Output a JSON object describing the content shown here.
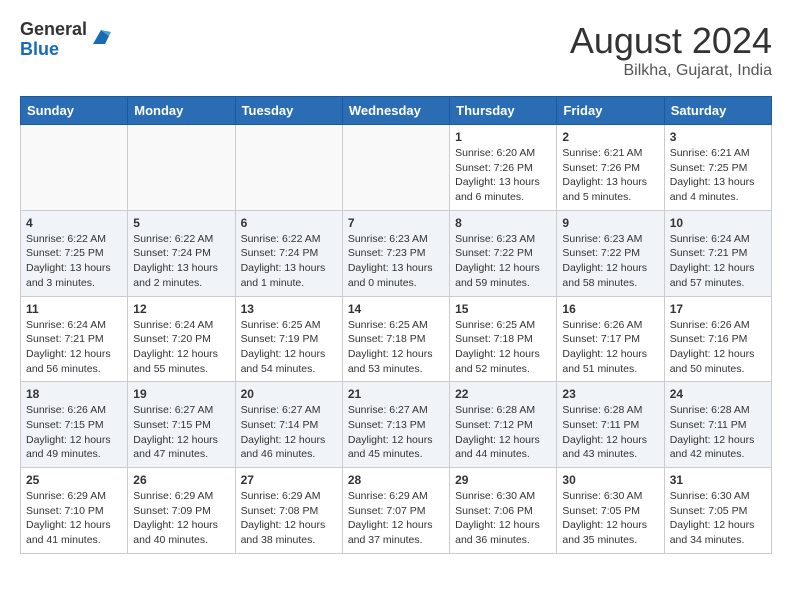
{
  "header": {
    "logo_general": "General",
    "logo_blue": "Blue",
    "month_year": "August 2024",
    "location": "Bilkha, Gujarat, India"
  },
  "calendar": {
    "days_of_week": [
      "Sunday",
      "Monday",
      "Tuesday",
      "Wednesday",
      "Thursday",
      "Friday",
      "Saturday"
    ],
    "weeks": [
      [
        {
          "day": "",
          "info": ""
        },
        {
          "day": "",
          "info": ""
        },
        {
          "day": "",
          "info": ""
        },
        {
          "day": "",
          "info": ""
        },
        {
          "day": "1",
          "info": "Sunrise: 6:20 AM\nSunset: 7:26 PM\nDaylight: 13 hours\nand 6 minutes."
        },
        {
          "day": "2",
          "info": "Sunrise: 6:21 AM\nSunset: 7:26 PM\nDaylight: 13 hours\nand 5 minutes."
        },
        {
          "day": "3",
          "info": "Sunrise: 6:21 AM\nSunset: 7:25 PM\nDaylight: 13 hours\nand 4 minutes."
        }
      ],
      [
        {
          "day": "4",
          "info": "Sunrise: 6:22 AM\nSunset: 7:25 PM\nDaylight: 13 hours\nand 3 minutes."
        },
        {
          "day": "5",
          "info": "Sunrise: 6:22 AM\nSunset: 7:24 PM\nDaylight: 13 hours\nand 2 minutes."
        },
        {
          "day": "6",
          "info": "Sunrise: 6:22 AM\nSunset: 7:24 PM\nDaylight: 13 hours\nand 1 minute."
        },
        {
          "day": "7",
          "info": "Sunrise: 6:23 AM\nSunset: 7:23 PM\nDaylight: 13 hours\nand 0 minutes."
        },
        {
          "day": "8",
          "info": "Sunrise: 6:23 AM\nSunset: 7:22 PM\nDaylight: 12 hours\nand 59 minutes."
        },
        {
          "day": "9",
          "info": "Sunrise: 6:23 AM\nSunset: 7:22 PM\nDaylight: 12 hours\nand 58 minutes."
        },
        {
          "day": "10",
          "info": "Sunrise: 6:24 AM\nSunset: 7:21 PM\nDaylight: 12 hours\nand 57 minutes."
        }
      ],
      [
        {
          "day": "11",
          "info": "Sunrise: 6:24 AM\nSunset: 7:21 PM\nDaylight: 12 hours\nand 56 minutes."
        },
        {
          "day": "12",
          "info": "Sunrise: 6:24 AM\nSunset: 7:20 PM\nDaylight: 12 hours\nand 55 minutes."
        },
        {
          "day": "13",
          "info": "Sunrise: 6:25 AM\nSunset: 7:19 PM\nDaylight: 12 hours\nand 54 minutes."
        },
        {
          "day": "14",
          "info": "Sunrise: 6:25 AM\nSunset: 7:18 PM\nDaylight: 12 hours\nand 53 minutes."
        },
        {
          "day": "15",
          "info": "Sunrise: 6:25 AM\nSunset: 7:18 PM\nDaylight: 12 hours\nand 52 minutes."
        },
        {
          "day": "16",
          "info": "Sunrise: 6:26 AM\nSunset: 7:17 PM\nDaylight: 12 hours\nand 51 minutes."
        },
        {
          "day": "17",
          "info": "Sunrise: 6:26 AM\nSunset: 7:16 PM\nDaylight: 12 hours\nand 50 minutes."
        }
      ],
      [
        {
          "day": "18",
          "info": "Sunrise: 6:26 AM\nSunset: 7:15 PM\nDaylight: 12 hours\nand 49 minutes."
        },
        {
          "day": "19",
          "info": "Sunrise: 6:27 AM\nSunset: 7:15 PM\nDaylight: 12 hours\nand 47 minutes."
        },
        {
          "day": "20",
          "info": "Sunrise: 6:27 AM\nSunset: 7:14 PM\nDaylight: 12 hours\nand 46 minutes."
        },
        {
          "day": "21",
          "info": "Sunrise: 6:27 AM\nSunset: 7:13 PM\nDaylight: 12 hours\nand 45 minutes."
        },
        {
          "day": "22",
          "info": "Sunrise: 6:28 AM\nSunset: 7:12 PM\nDaylight: 12 hours\nand 44 minutes."
        },
        {
          "day": "23",
          "info": "Sunrise: 6:28 AM\nSunset: 7:11 PM\nDaylight: 12 hours\nand 43 minutes."
        },
        {
          "day": "24",
          "info": "Sunrise: 6:28 AM\nSunset: 7:11 PM\nDaylight: 12 hours\nand 42 minutes."
        }
      ],
      [
        {
          "day": "25",
          "info": "Sunrise: 6:29 AM\nSunset: 7:10 PM\nDaylight: 12 hours\nand 41 minutes."
        },
        {
          "day": "26",
          "info": "Sunrise: 6:29 AM\nSunset: 7:09 PM\nDaylight: 12 hours\nand 40 minutes."
        },
        {
          "day": "27",
          "info": "Sunrise: 6:29 AM\nSunset: 7:08 PM\nDaylight: 12 hours\nand 38 minutes."
        },
        {
          "day": "28",
          "info": "Sunrise: 6:29 AM\nSunset: 7:07 PM\nDaylight: 12 hours\nand 37 minutes."
        },
        {
          "day": "29",
          "info": "Sunrise: 6:30 AM\nSunset: 7:06 PM\nDaylight: 12 hours\nand 36 minutes."
        },
        {
          "day": "30",
          "info": "Sunrise: 6:30 AM\nSunset: 7:05 PM\nDaylight: 12 hours\nand 35 minutes."
        },
        {
          "day": "31",
          "info": "Sunrise: 6:30 AM\nSunset: 7:05 PM\nDaylight: 12 hours\nand 34 minutes."
        }
      ]
    ]
  }
}
